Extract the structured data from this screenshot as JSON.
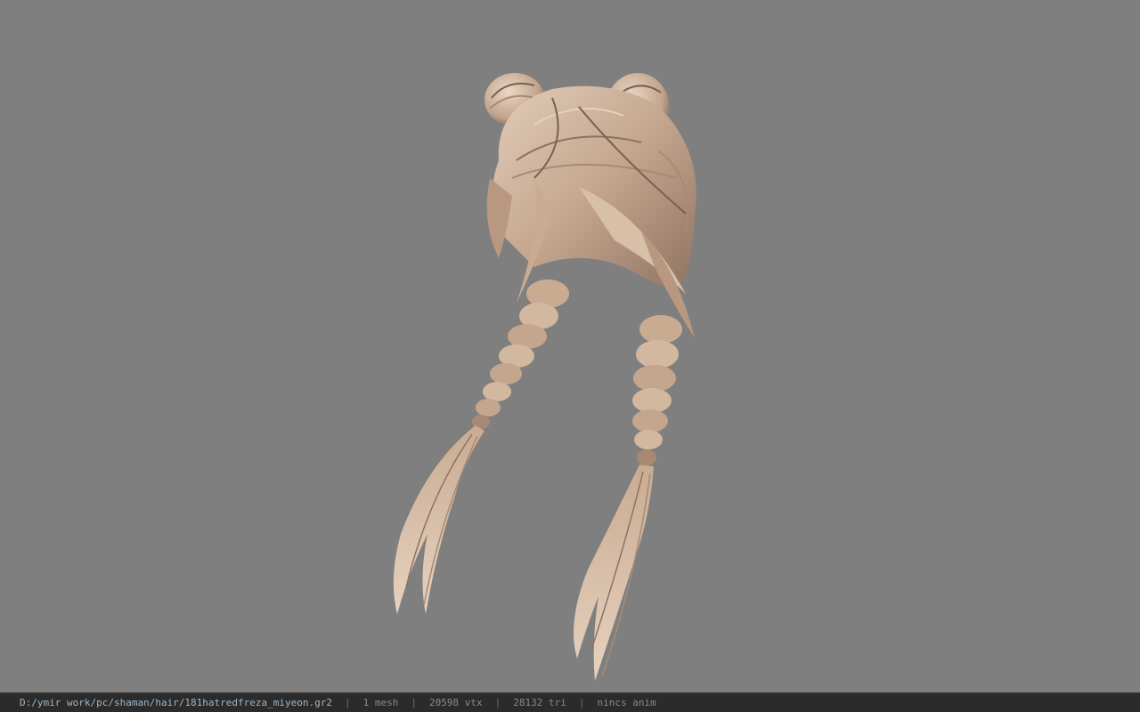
{
  "viewport": {
    "background": "#7f7f7f",
    "model": {
      "hair_base_color": "#c9ab92",
      "hair_shadow_color": "#7a6150",
      "hair_highlight_color": "#e6d2bf"
    }
  },
  "status_bar": {
    "file_path": "D:/ymir work/pc/shaman/hair/181hatredfreza_miyeon.gr2",
    "mesh_count": "1 mesh",
    "vertex_count": "20598 vtx",
    "triangle_count": "28132 tri",
    "anim_status": "nincs anim"
  }
}
